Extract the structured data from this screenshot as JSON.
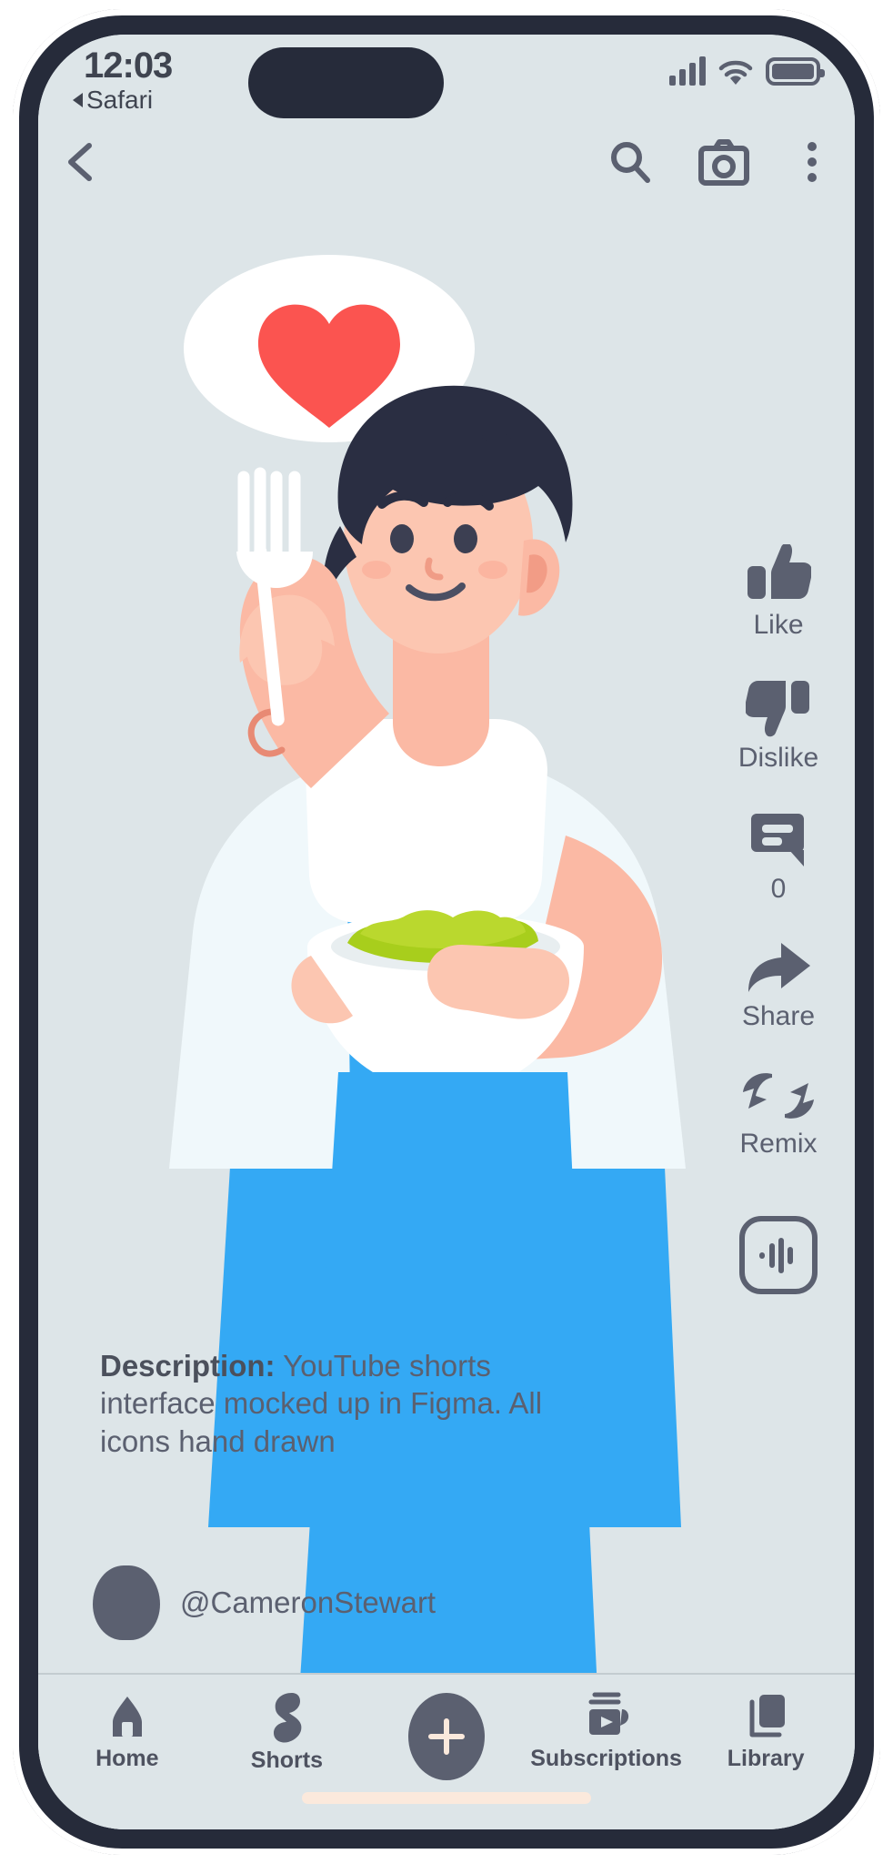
{
  "status_bar": {
    "time": "12:03",
    "back_app": "Safari",
    "icons": [
      "cellular-signal-icon",
      "wifi-icon",
      "battery-icon"
    ]
  },
  "top_nav": {
    "back": "back-chevron-icon",
    "search": "search-icon",
    "camera": "camera-icon",
    "more": "kebab-menu-icon"
  },
  "video": {
    "speech_bubble_emoji": "heart-icon",
    "heart_color": "#fb5450",
    "background_color": "#dde5e8",
    "apron_color": "#34a9f4",
    "skin_color": "#fbb9a4",
    "hair_color": "#2a2e42",
    "salad_color": "#a8ce1c"
  },
  "action_rail": [
    {
      "icon": "thumbs-up-icon",
      "label": "Like"
    },
    {
      "icon": "thumbs-down-icon",
      "label": "Dislike"
    },
    {
      "icon": "comment-icon",
      "label": "0"
    },
    {
      "icon": "share-icon",
      "label": "Share"
    },
    {
      "icon": "remix-icon",
      "label": "Remix"
    }
  ],
  "audio_button": {
    "icon": "sound-wave-icon"
  },
  "description": {
    "label": "Description:",
    "text": "YouTube shorts interface mocked up in Figma. All icons hand drawn"
  },
  "channel": {
    "avatar": "avatar-icon",
    "handle": "@CameronStewart"
  },
  "bottom_nav": {
    "items": [
      {
        "icon": "home-icon",
        "label": "Home"
      },
      {
        "icon": "shorts-icon",
        "label": "Shorts"
      },
      {
        "icon": "plus-icon",
        "label": ""
      },
      {
        "icon": "subscriptions-icon",
        "label": "Subscriptions"
      },
      {
        "icon": "library-icon",
        "label": "Library"
      }
    ]
  }
}
